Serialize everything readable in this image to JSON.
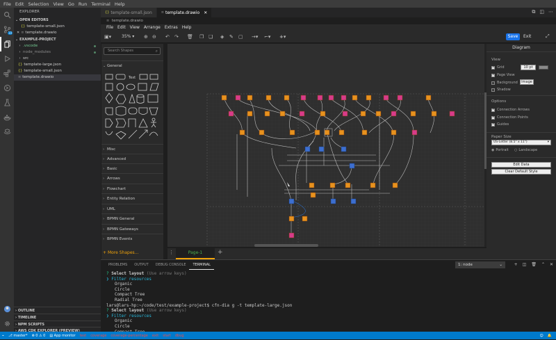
{
  "menubar": [
    "File",
    "Edit",
    "Selection",
    "View",
    "Go",
    "Run",
    "Terminal",
    "Help"
  ],
  "activity": [
    "explorer-icon",
    "search-icon",
    "source-control-icon",
    "run-debug-icon",
    "extensions-icon",
    "remote-icon",
    "test-icon",
    "docker-icon",
    "aws-icon",
    "account-icon",
    "settings-icon"
  ],
  "badge": "10",
  "sidebar": {
    "title": "EXPLORER",
    "open_editors": "OPEN EDITORS",
    "open_files": [
      "template-small.json",
      "template.drawio"
    ],
    "project": "EXAMPLE-PROJECT",
    "files": [
      ".vscode",
      "node_modules",
      "src",
      "template-large.json",
      "template-small.json",
      "template.drawio"
    ],
    "bottom": [
      "OUTLINE",
      "TIMELINE",
      "NPM SCRIPTS",
      "AWS CDK EXPLORER (PREVIEW)"
    ]
  },
  "tabs": [
    "template-small.json",
    "template.drawio"
  ],
  "breadcrumb": "template.drawio",
  "drawio": {
    "menu": [
      "File",
      "Edit",
      "View",
      "Arrange",
      "Extras",
      "Help"
    ],
    "zoom": "35%",
    "save": "Save",
    "exit": "Exit",
    "search_placeholder": "Search Shapes",
    "categories": [
      "General",
      "Misc",
      "Advanced",
      "Basic",
      "Arrows",
      "Flowchart",
      "Entity Relation",
      "UML",
      "BPMN General",
      "BPMN Gateways",
      "BPMN Events"
    ],
    "more_shapes": "More Shapes...",
    "page_tab": "Page-1",
    "format": {
      "header": "Diagram",
      "view": "View",
      "grid": "Grid",
      "grid_value": "10 pt",
      "page_view": "Page View",
      "background": "Background",
      "image_btn": "Image",
      "shadow": "Shadow",
      "options": "Options",
      "connection_arrows": "Connection Arrows",
      "connection_points": "Connection Points",
      "guides": "Guides",
      "paper_size": "Paper Size",
      "paper_value": "US-Letter (8.5\" x 11\")",
      "portrait": "Portrait",
      "landscape": "Landscape",
      "edit_data": "Edit Data",
      "clear_style": "Clear Default Style"
    }
  },
  "panel": {
    "tabs": [
      "PROBLEMS",
      "OUTPUT",
      "DEBUG CONSOLE",
      "TERMINAL"
    ],
    "terminal_select": "1: node",
    "lines": {
      "q1": "Select layout",
      "hint": "(Use arrow keys)",
      "filter": "Filter resources",
      "opt1": "Organic",
      "opt2": "Circle",
      "opt3": "Compact Tree",
      "opt4": "Radial Tree",
      "prompt_user": "lars@lars-hp",
      "prompt_path": ":~/code/test/example-project$",
      "command": " cfn-dia g -t template-large.json"
    }
  },
  "status": {
    "branch": "master*",
    "problems": "⊗ 0 ⚠ 0",
    "monitor": "App monitor",
    "items": [
      "test",
      "coverage",
      "coverage-percentage",
      "exit",
      "start",
      "dbug"
    ]
  }
}
